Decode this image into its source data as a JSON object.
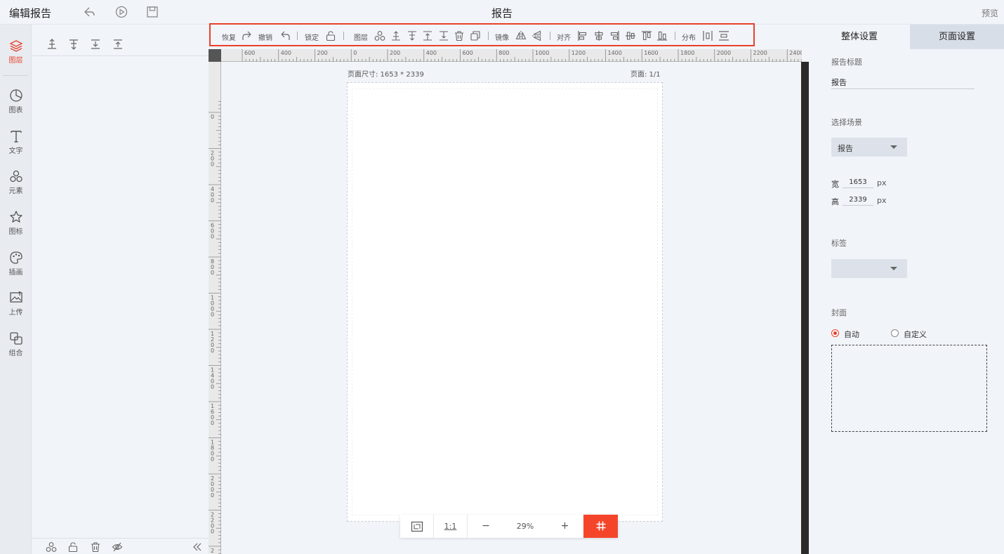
{
  "header": {
    "app_title": "编辑报告",
    "doc_title": "报告",
    "preview_label": "预览"
  },
  "rail": {
    "items": [
      {
        "label": "图层",
        "icon": "layers-icon"
      },
      {
        "label": "图表",
        "icon": "chart-icon"
      },
      {
        "label": "文字",
        "icon": "text-icon"
      },
      {
        "label": "元素",
        "icon": "elements-icon"
      },
      {
        "label": "图标",
        "icon": "star-icon"
      },
      {
        "label": "插画",
        "icon": "palette-icon"
      },
      {
        "label": "上传",
        "icon": "upload-image-icon"
      },
      {
        "label": "组合",
        "icon": "group-icon"
      }
    ]
  },
  "toolbar": {
    "redo_label": "恢复",
    "undo_label": "撤销",
    "lock_label": "锁定",
    "layer_label": "图层",
    "mirror_label": "镜像",
    "align_label": "对齐",
    "distribute_label": "分布"
  },
  "ruler": {
    "h_labels": [
      "600",
      "400",
      "200",
      "0",
      "200",
      "400",
      "600",
      "800",
      "1000",
      "1200",
      "1400",
      "1600",
      "1800",
      "2000",
      "2200",
      "2400"
    ],
    "v_labels": [
      "0",
      "200",
      "400",
      "600",
      "800",
      "1000",
      "1200",
      "1400",
      "1600",
      "1800",
      "2000",
      "2200",
      "2400"
    ]
  },
  "canvas": {
    "page_size": "页面尺寸: 1653 * 2339",
    "page_number": "页面: 1/1"
  },
  "zoom": {
    "ratio_label": "1:1",
    "minus": "−",
    "level": "29%",
    "plus": "+"
  },
  "right_panel": {
    "tab_overall": "整体设置",
    "tab_page": "页面设置",
    "report_title_label": "报告标题",
    "report_title_value": "报告",
    "scene_label": "选择场景",
    "scene_value": "报告",
    "width_label": "宽",
    "width_value": "1653",
    "height_label": "高",
    "height_value": "2339",
    "unit": "px",
    "tag_label": "标签",
    "tag_value": "",
    "cover_label": "封面",
    "cover_auto": "自动",
    "cover_custom": "自定义"
  },
  "colors": {
    "accent": "#e8412b",
    "grid_button": "#f4452b",
    "background": "#f1f4f9",
    "scrollbar": "#2b2b2b"
  }
}
